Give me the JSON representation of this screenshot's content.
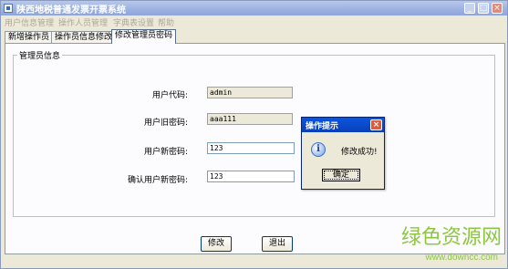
{
  "window": {
    "title": "陕西地税普通发票开票系统"
  },
  "menu": [
    "用户信息管理",
    "操作人员管理",
    "字典表设置",
    "帮助"
  ],
  "tabs": [
    "新增操作员",
    "操作员信息修改",
    "修改管理员密码"
  ],
  "active_tab": 2,
  "group": {
    "title": "管理员信息"
  },
  "form": {
    "user_code_label": "用户代码:",
    "user_code_value": "admin",
    "old_password_label": "用户旧密码:",
    "old_password_value": "aaa111",
    "new_password_label": "用户新密码:",
    "new_password_value": "123",
    "confirm_password_label": "确认用户新密码:",
    "confirm_password_value": "123"
  },
  "buttons": {
    "modify": "修改",
    "exit": "退出"
  },
  "dialog": {
    "title": "操作提示",
    "message": "修改成功!",
    "ok": "确定",
    "icon": "info-icon"
  },
  "watermark": {
    "text": "绿色资源网",
    "url": "www.downcc.com"
  }
}
